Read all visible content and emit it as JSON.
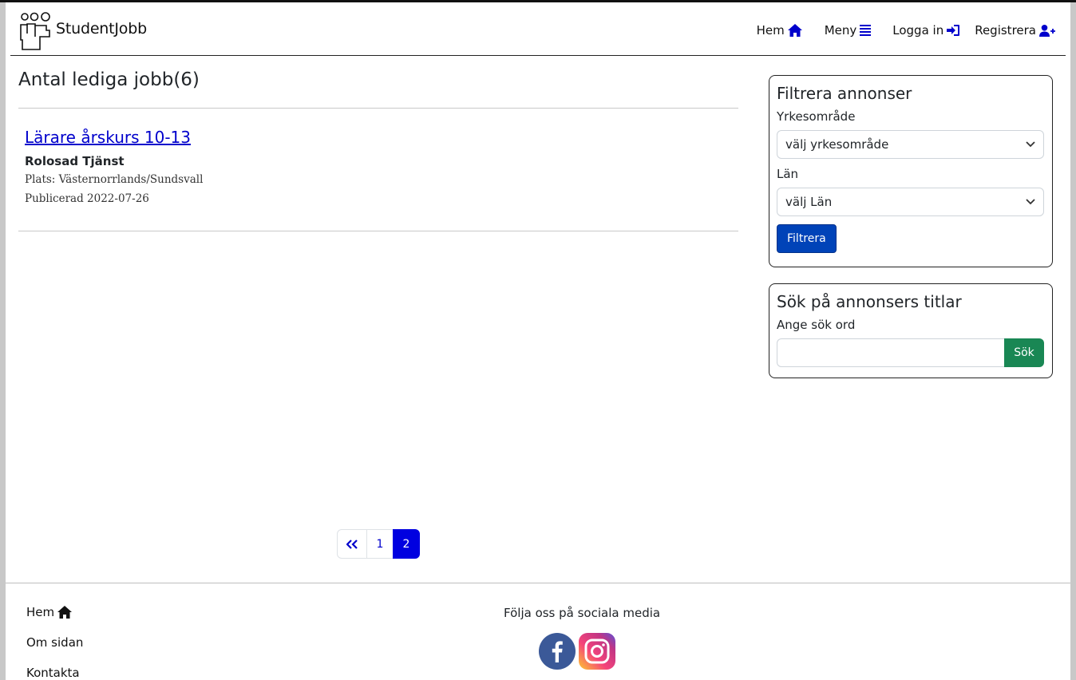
{
  "header": {
    "brand": "StudentJobb",
    "nav": {
      "home": "Hem",
      "menu": "Meny",
      "login": "Logga in",
      "register": "Registrera"
    }
  },
  "main": {
    "title": "Antal lediga jobb(6)",
    "jobs": [
      {
        "title": "Lärare årskurs 10-13",
        "company": "Rolosad Tjänst",
        "location": "Plats: Västernorrlands/Sundsvall",
        "published": "Publicerad 2022-07-26"
      }
    ]
  },
  "filter": {
    "title": "Filtrera annonser",
    "area_label": "Yrkesområde",
    "area_value": "välj yrkesområde",
    "county_label": "Län",
    "county_value": "välj Län",
    "button": "Filtrera"
  },
  "search": {
    "title": "Sök på annonsers titlar",
    "label": "Ange sök ord",
    "value": "",
    "button": "Sök"
  },
  "pagination": {
    "pages": [
      "1",
      "2"
    ],
    "current": "2"
  },
  "footer": {
    "links": [
      "Hem",
      "Om sidan",
      "Kontakta"
    ],
    "social_title": "Följa oss på sociala media",
    "social_icons": [
      "facebook-icon",
      "instagram-icon"
    ]
  },
  "colors": {
    "link": "#0000cc",
    "primary_button": "#0043b8",
    "success_button": "#198754",
    "active_page": "#0000e0"
  }
}
